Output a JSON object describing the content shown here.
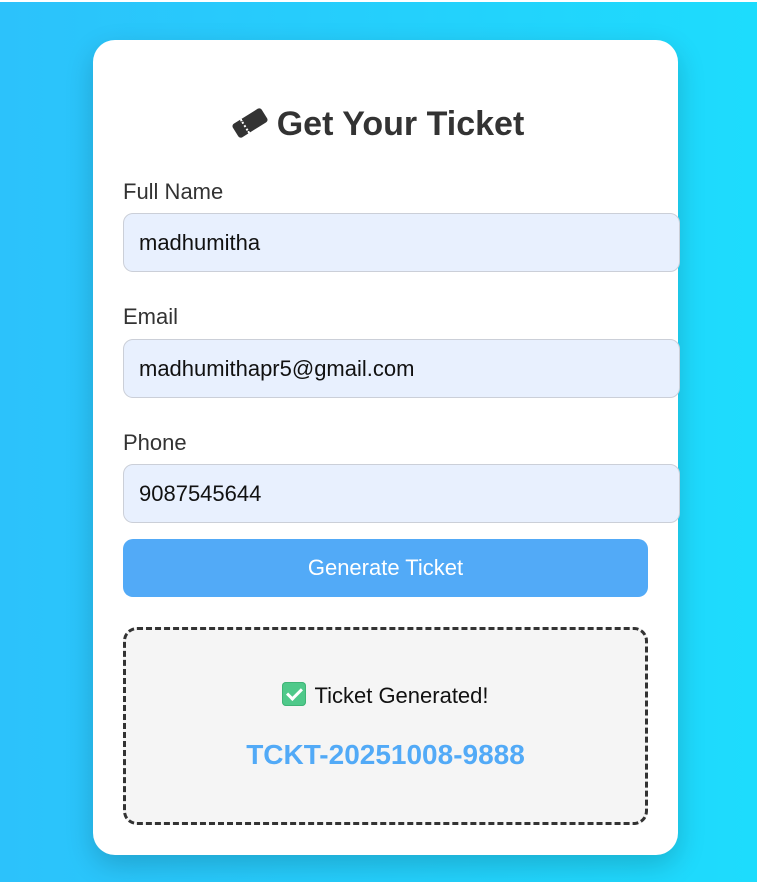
{
  "page": {
    "title_icon": "ticket-icon",
    "title": "Get Your Ticket"
  },
  "form": {
    "full_name_label": "Full Name",
    "full_name_value": "madhumitha",
    "email_label": "Email",
    "email_value": "madhumithapr5@gmail.com",
    "phone_label": "Phone",
    "phone_value": "9087545644",
    "submit_label": "Generate Ticket"
  },
  "result": {
    "status_icon": "check-icon",
    "status_text": "Ticket Generated!",
    "ticket_code": "TCKT-20251008-9888"
  },
  "colors": {
    "background_start": "#2cc2fb",
    "background_end": "#1ddcfd",
    "accent": "#52aaf7",
    "input_background": "#e8f0fe",
    "text": "#333333"
  }
}
